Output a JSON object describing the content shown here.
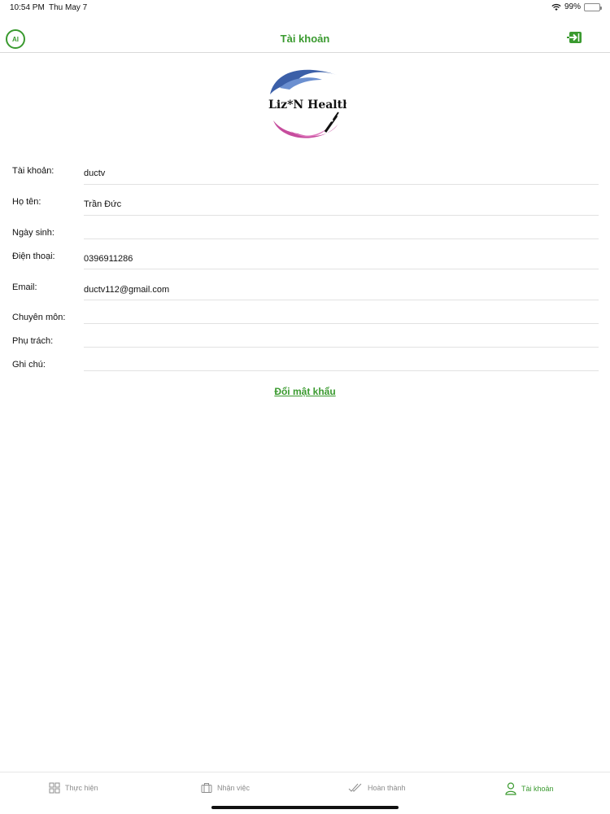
{
  "status_bar": {
    "time": "10:54 PM",
    "date": "Thu May 7",
    "battery_text": "99%",
    "battery_level": 0.99
  },
  "nav": {
    "title": "Tài khoản",
    "left_icon": "ai-logo-icon",
    "right_icon": "logout-icon"
  },
  "logo": {
    "brand_text": "Liz*N Health"
  },
  "form": {
    "account_label": "Tài khoản:",
    "account_value": "ductv",
    "fullname_label": "Họ tên:",
    "fullname_value": "Trần Đức",
    "birthday_label": "Ngày sinh:",
    "birthday_value": "",
    "phone_label": "Điện thoại:",
    "phone_value": "0396911286",
    "email_label": "Email:",
    "email_value": "ductv112@gmail.com",
    "specialty_label": "Chuyên môn:",
    "specialty_value": "",
    "responsible_label": "Phụ trách:",
    "responsible_value": "",
    "note_label": "Ghi chú:",
    "note_value": ""
  },
  "change_password": "Đổi mật khẩu",
  "tabs": [
    {
      "label": "Thực hiện",
      "icon": "grid-icon",
      "active": false
    },
    {
      "label": "Nhận việc",
      "icon": "briefcase-icon",
      "active": false
    },
    {
      "label": "Hoàn thành",
      "icon": "double-check-icon",
      "active": false
    },
    {
      "label": "Tài khoản",
      "icon": "person-icon",
      "active": true
    }
  ],
  "colors": {
    "accent": "#3a9a2f",
    "inactive": "#8c8c8c",
    "logo_blue": "#3b5fa8",
    "logo_pink": "#c64c9d"
  }
}
